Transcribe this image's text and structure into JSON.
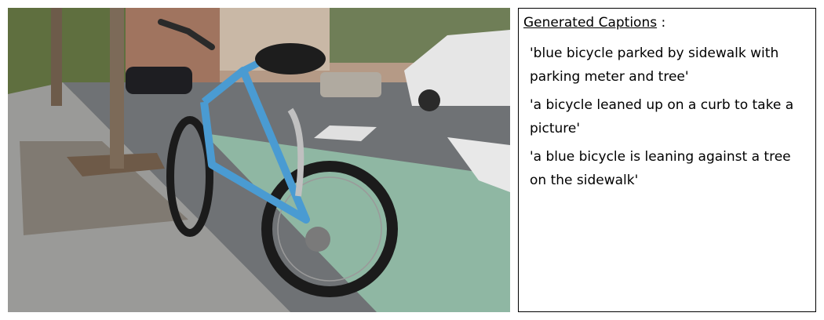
{
  "image": {
    "subject": "bicycle-on-sidewalk-photo"
  },
  "captions_panel": {
    "heading": "Generated Captions",
    "heading_suffix": " :",
    "captions": [
      "'blue bicycle parked by sidewalk with parking meter and tree'",
      "'a bicycle leaned up on a curb to take a picture'",
      "'a blue bicycle is leaning against a tree on the sidewalk'"
    ]
  },
  "colors": {
    "bicycle_frame": "#4a9bd2",
    "border": "#000000",
    "bike_lane": "#8fb7a3"
  }
}
